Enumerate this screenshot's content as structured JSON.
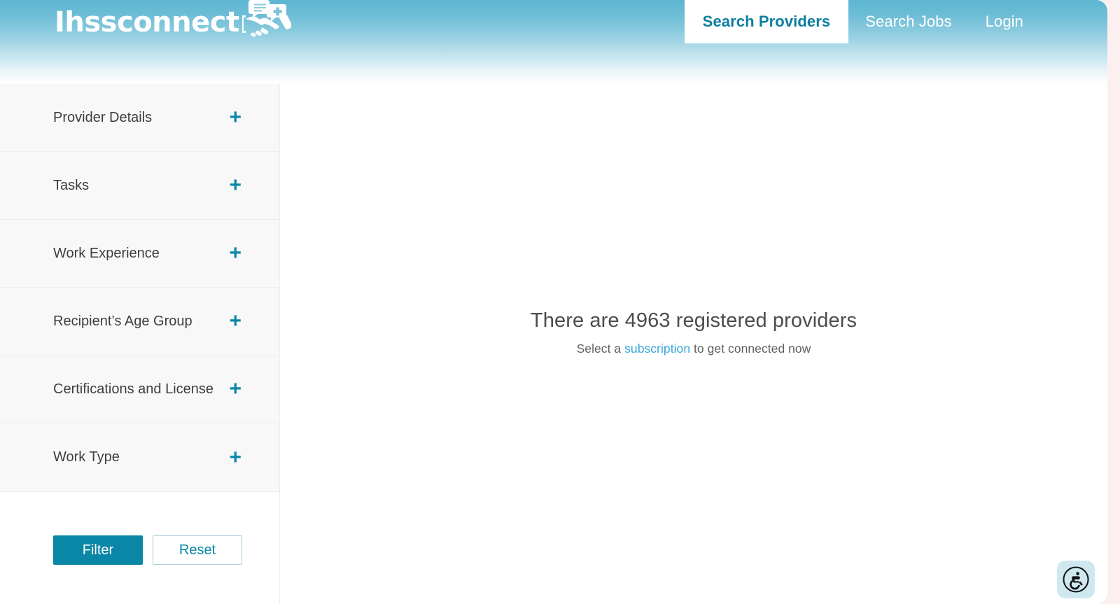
{
  "brand": {
    "wordmark": "IHSSconnect",
    "logo_icon": "handshake-speech-bubble-medical-icon",
    "logo_color": "#ffffff"
  },
  "colors": {
    "header_gradient_top": "#5cb5d2",
    "header_gradient_bottom": "#ffffff",
    "accent_teal": "#0a87a6",
    "link_blue": "#36a6d9",
    "sidebar_bg": "#f8f8f9",
    "page_backdrop": "#fbeff0"
  },
  "nav": {
    "items": [
      {
        "label": "Search Providers",
        "active": true
      },
      {
        "label": "Search Jobs",
        "active": false
      },
      {
        "label": "Login",
        "active": false
      }
    ]
  },
  "sidebar": {
    "filters": [
      {
        "label": "Provider Details",
        "expand_icon": "plus-icon",
        "expanded": false
      },
      {
        "label": "Tasks",
        "expand_icon": "plus-icon",
        "expanded": false
      },
      {
        "label": "Work Experience",
        "expand_icon": "plus-icon",
        "expanded": false
      },
      {
        "label": "Recipient’s Age Group",
        "expand_icon": "plus-icon",
        "expanded": false
      },
      {
        "label": "Certifications and License",
        "expand_icon": "plus-icon",
        "expanded": false
      },
      {
        "label": "Work Type",
        "expand_icon": "plus-icon",
        "expanded": false
      }
    ],
    "filter_button_label": "Filter",
    "reset_button_label": "Reset"
  },
  "main": {
    "results_heading": "There are 4963 registered providers",
    "provider_count": 4963,
    "subline_before": "Select a ",
    "subline_link": "subscription",
    "subline_after": " to get connected now"
  },
  "accessibility_widget": {
    "icon": "wheelchair-accessibility-icon",
    "background": "#cfe8f0"
  }
}
